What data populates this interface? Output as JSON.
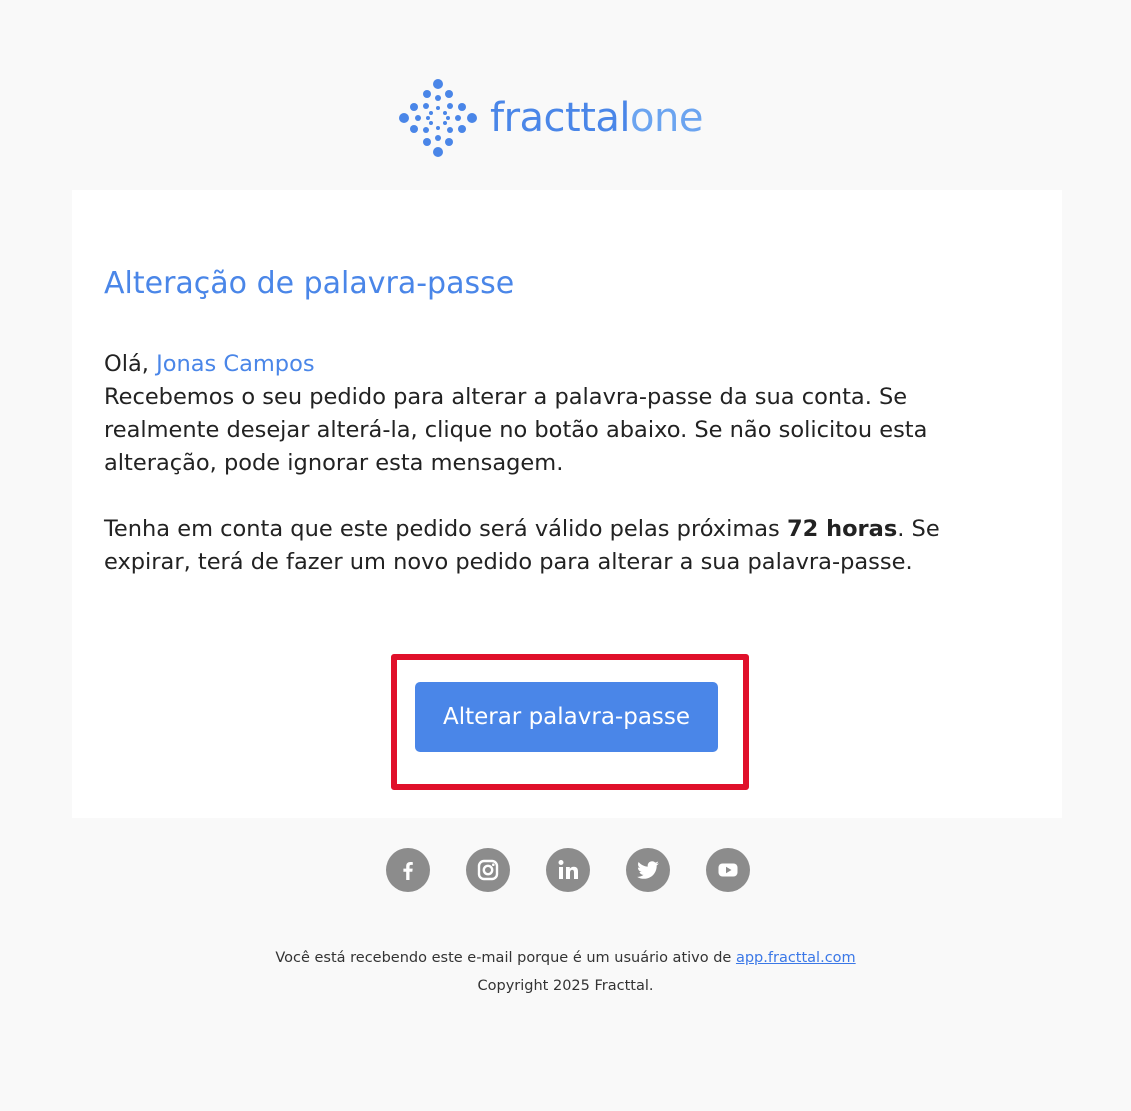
{
  "brand": {
    "name_part1": "fracttal",
    "name_part2": "one",
    "color_primary": "#4a86e8",
    "color_secondary": "#6ba4f0"
  },
  "email": {
    "title": "Alteração de palavra-passe",
    "greeting": "Olá,",
    "recipient_name": "Jonas Campos",
    "paragraph1": "Recebemos o seu pedido para alterar a palavra-passe da sua conta. Se realmente desejar alterá-la, clique no botão abaixo. Se não solicitou esta alteração, pode ignorar esta mensagem.",
    "paragraph2_before": "Tenha em conta que este pedido será válido pelas próximas ",
    "paragraph2_bold": "72 horas",
    "paragraph2_after": ". Se expirar, terá de fazer um novo pedido para alterar a sua palavra-passe.",
    "button_label": "Alterar palavra-passe",
    "button_color": "#4a86e8"
  },
  "annotation": {
    "highlight_color": "#e0102a"
  },
  "social": [
    {
      "icon": "facebook-icon"
    },
    {
      "icon": "instagram-icon"
    },
    {
      "icon": "linkedin-icon"
    },
    {
      "icon": "twitter-icon"
    },
    {
      "icon": "youtube-icon"
    }
  ],
  "footer": {
    "line1_text": "Você está recebendo este e-mail porque é um usuário ativo de ",
    "line1_link": "app.fracttal.com",
    "line2": "Copyright 2025 Fracttal."
  }
}
